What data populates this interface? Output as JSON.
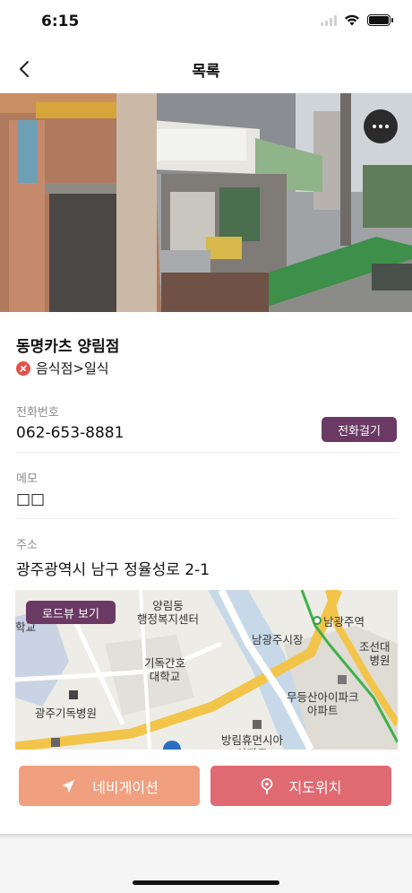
{
  "status_bar": {
    "time": "6:15"
  },
  "nav": {
    "title": "목록",
    "back_icon": "chevron-left-icon"
  },
  "hero": {
    "more_icon": "more-horizontal-icon"
  },
  "place": {
    "name": "동명카츠 양림점",
    "category": "음식점>일식",
    "category_icon": "restaurant-icon",
    "category_color": "#e0524b"
  },
  "phone": {
    "label": "전화번호",
    "value": "062-653-8881",
    "call_label": "전화걸기"
  },
  "memo": {
    "label": "메모",
    "value": "□□"
  },
  "address": {
    "label": "주소",
    "value": "광주광역시 남구 정율성로 2-1"
  },
  "map": {
    "roadview_label": "로드뷰 보기",
    "labels": {
      "yangrim": "양림동\n행정복지센터",
      "school": "학교",
      "namgwangju_market": "남광주시장",
      "namgwangju_station": "남광주역",
      "joseon": "조선대\n병원",
      "nursing": "기독간호\n대학교",
      "hospital": "광주기독병원",
      "mudeung": "무등산아이파크\n아파트",
      "banglim": "방림휴먼시아\n아파트"
    }
  },
  "actions": {
    "navigation_label": "네비게이션",
    "map_label": "지도위치"
  },
  "colors": {
    "accent": "#6a3a64",
    "navigation": "#f0a07f",
    "map_location": "#e06a72"
  }
}
